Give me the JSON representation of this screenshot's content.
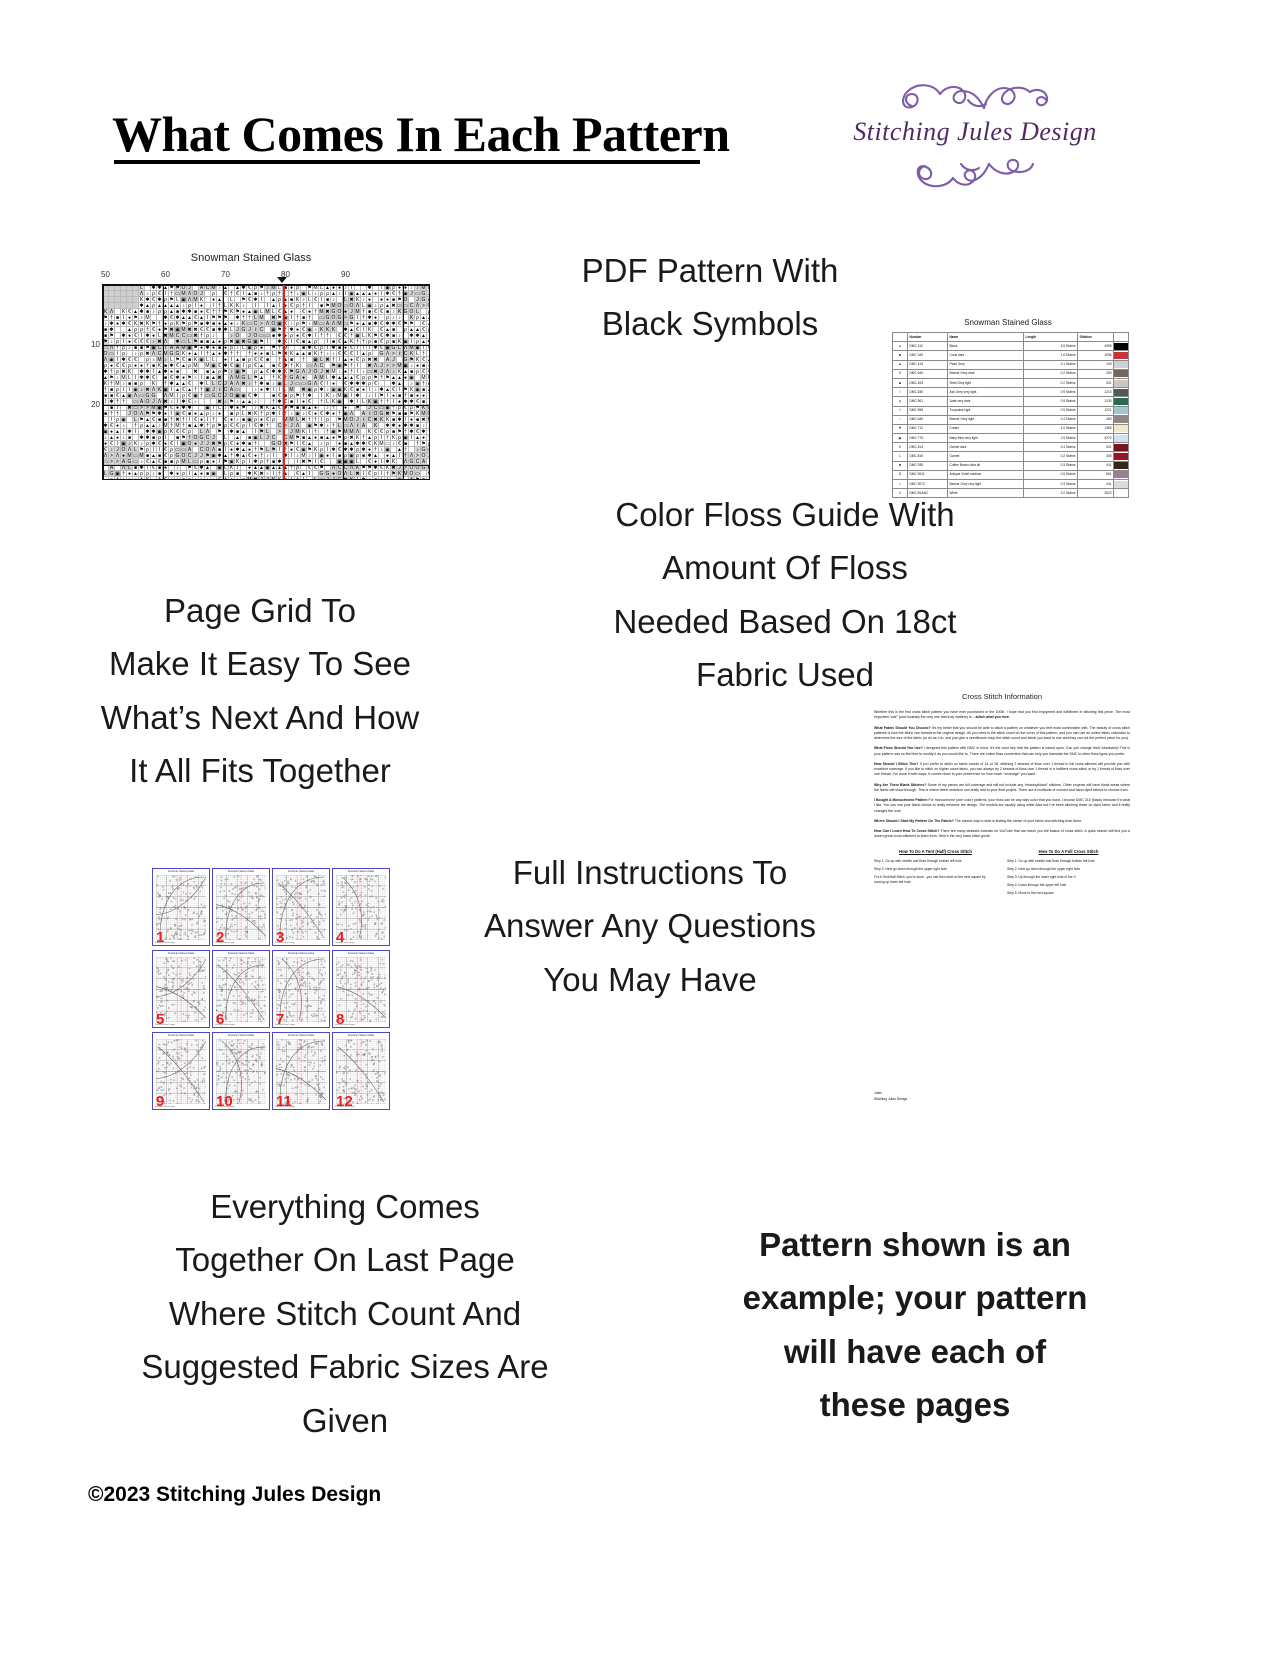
{
  "header": {
    "title": "What Comes In Each Pattern",
    "logo": {
      "brand": "Stitching Jules Design",
      "flourish_top": "❧❁❦",
      "flourish_bottom": "❦❁❧",
      "text_color": "#512b63",
      "flourish_color": "#7f5da6"
    }
  },
  "callouts": {
    "pdf_pattern": "PDF Pattern With\nBlack Symbols",
    "floss_guide": "Color Floss Guide With\nAmount Of Floss\nNeeded Based On 18ct\nFabric Used",
    "page_grid": "Page Grid To\nMake It Easy To See\nWhat’s Next And How\nIt All Fits Together",
    "instructions": "Full Instructions To\nAnswer Any Questions\nYou May Have",
    "last_page": "Everything Comes\nTogether On Last Page\nWhere Stitch Count And\nSuggested Fabric Sizes Are\nGiven",
    "disclaimer": "Pattern shown is an\nexample; your pattern\nwill have each of\nthese pages"
  },
  "footer": {
    "copyright": "©2023 Stitching Jules Design"
  },
  "chart": {
    "title": "Snowman Stained Glass",
    "column_labels": [
      "50",
      "60",
      "70",
      "80",
      "90"
    ],
    "row_labels": [
      "10",
      "20"
    ],
    "center_line_color": "#e8211a",
    "symbols": [
      "●",
      "✱",
      "▲",
      "€",
      "■",
      "I",
      "ρ",
      "†",
      "♪",
      "⚑",
      "▣",
      "K",
      "L",
      "✖",
      "M",
      "▭",
      "Λ",
      "G",
      "J",
      "O",
      "C",
      "A",
      ">",
      "ℓ"
    ]
  },
  "floss_guide": {
    "title": "Snowman Stained Glass",
    "columns": [
      "",
      "Number",
      "Name",
      "Length",
      "Stitches",
      ""
    ],
    "rows": [
      {
        "symbol": "●",
        "number": "DMC    310",
        "name": "Black",
        "length": "3.5 Skeins",
        "stitches": "4999",
        "color": "#000000"
      },
      {
        "symbol": "✱",
        "number": "DMC    349",
        "name": "Coral dark",
        "length": "1.6 Skeins",
        "stitches": "1096",
        "color": "#c4343b"
      },
      {
        "symbol": "▲",
        "number": "DMC    415",
        "name": "Pearl Grey",
        "length": "0.1 Skeins",
        "stitches": "109",
        "color": "#ced2d6"
      },
      {
        "symbol": "€",
        "number": "DMC    646",
        "name": "Beaver Grey dark",
        "length": "0.2 Skeins",
        "stitches": "250",
        "color": "#6e6a63"
      },
      {
        "symbol": "■",
        "number": "DMC    453",
        "name": "Shell Grey light",
        "length": "0.2 Skeins",
        "stitches": "321",
        "color": "#cfc6bf"
      },
      {
        "symbol": "I",
        "number": "DMC    535",
        "name": "Ash Grey very light",
        "length": "0.9 Skeins",
        "stitches": "1210",
        "color": "#55575a"
      },
      {
        "symbol": "ρ",
        "number": "DMC    561",
        "name": "Jade very dark",
        "length": "0.9 Skeins",
        "stitches": "1230",
        "color": "#2b6b4f"
      },
      {
        "symbol": "†",
        "number": "DMC    598",
        "name": "Turquoise light",
        "length": "0.9 Skeins",
        "stitches": "1221",
        "color": "#9ec9cf"
      },
      {
        "symbol": "♪",
        "number": "DMC    646",
        "name": "Beaver Grey light",
        "length": "0.4 Skeins",
        "stitches": "483",
        "color": "#8d8880"
      },
      {
        "symbol": "⚑",
        "number": "DMC    712",
        "name": "Cream",
        "length": "1.0 Skeins",
        "stitches": "1383",
        "color": "#f2e6cf"
      },
      {
        "symbol": "▣",
        "number": "DMC    775",
        "name": "Baby Blue very light",
        "length": "2.5 Skeins",
        "stitches": "3270",
        "color": "#cfe0ee"
      },
      {
        "symbol": "K",
        "number": "DMC    814",
        "name": "Garnet dark",
        "length": "0.4 Skeins",
        "stitches": "521",
        "color": "#7b1020"
      },
      {
        "symbol": "L",
        "number": "DMC    816",
        "name": "Garnet",
        "length": "0.2 Skeins",
        "stitches": "305",
        "color": "#971325"
      },
      {
        "symbol": "✖",
        "number": "DMC    938",
        "name": "Coffee Brown ultra dk",
        "length": "0.3 Skeins",
        "stitches": "441",
        "color": "#3b2317"
      },
      {
        "symbol": "D",
        "number": "DMC   3041",
        "name": "Antique Violet medium",
        "length": "0.5 Skeins",
        "stitches": "661",
        "color": "#9a7f92"
      },
      {
        "symbol": ">",
        "number": "DMC   3072",
        "name": "Beaver Grey very light",
        "length": "0.3 Skeins",
        "stitches": "441",
        "color": "#dcdcd4"
      },
      {
        "symbol": "Λ",
        "number": "DMC  BLANC",
        "name": "White",
        "length": "2.0 Skeins",
        "stitches": "2622",
        "color": "#ffffff"
      }
    ]
  },
  "page_grid": {
    "thumb_title": "Snowman Stained Glass",
    "thumb_footer": "Stitching Jules Design",
    "page_numbers": [
      "1",
      "2",
      "3",
      "4",
      "5",
      "6",
      "7",
      "8",
      "9",
      "10",
      "11",
      "12"
    ],
    "border_color": "#4b49c9",
    "number_color": "#ee1c1c"
  },
  "instructions": {
    "title": "Cross Stitch Information",
    "intro": "Whether this is the first cross stitch pattern you have ever purchased or the 100th, I hope that you find enjoyment and fulfillment in stitching this piece. The most important “rule” (and honestly the only one that truly matters) is – stitch what you love.",
    "intro_emphasis": "stitch what you love.",
    "sections": [
      {
        "heading": "What Fabric Should You Choose?",
        "body": " It’s my belief that you should be able to stitch a pattern on whatever you feel most comfortable with. The beauty of cross stitch patterns is how the fabric can transform the original design. All you need is the stitch count on the cover of this pattern, and you can use an online fabric calculator to determine the size of the fabric (or do as I do, and just give a needlework shop the stitch count and fabric you want to use and they can cut the perfect piece for you)."
      },
      {
        "heading": "What Floss Should You Use?",
        "body": " I designed this pattern with DMC in mind. It’s the color key that the pattern is based upon. Can you change that? Absolutely! This is your pattern now so feel free to modify it as you would like to. There are online floss converters that can help you translate the DMC to other floss types you prefer."
      },
      {
        "heading": "How Should I Stitch This?",
        "body": " If you prefer to stitch on fabric counts of 14 or 18, stitching 2 strands of floss over 1 thread in full cross-stitches will provide you with excellent coverage. If you like to stitch on higher count fabric, you can always try 2 strands of floss over 1 thread in a half/tent cross-stitch or try 1 thread of floss over one thread. I’ve done it both ways. It comes down to your preference for how much “coverage” you want."
      },
      {
        "heading": "Why Are There Blank Stitches?",
        "body": " Some of my pieces are full-coverage and will not include any “missing/blank” stitches. Other projects will have blank areas where the fabric will show through. This is where fabric selection can really add to your final project. There are a multitude of colored and hand-dyed fabrics to choose from."
      },
      {
        "heading": "I Bought A Monochrome Pattern",
        "body": " For monochrome (one color) patterns, your floss can be any dark color that you want. I choose DMC 310 (black) because it’s what I like. You can use your fabric choice to really enhance the design. The models are usually using white Aida but I’ve been stitching these on dyed fabric and it really changes the look."
      },
      {
        "heading": "Where Should I Start My Pattern On The Fabric?",
        "body": " The classic way to start is finding the center of your fabric and stitching from there."
      },
      {
        "heading": "How Can I Learn How To Cross Stitch?",
        "body": " There are many fantastic tutorials on YouTube that can teach you the basics of cross stitch. A quick search will find you a dozen great cross-stitchers to learn from. Here’s the very basic stitch guide."
      }
    ],
    "tent_stitch": {
      "heading": "How To Do A Tent (Half) Cross Stitch",
      "steps": [
        "Step 1. Go up with needle and floss through bottom left hole",
        "Step 2. Next go down through the upper right hole"
      ],
      "note": "For A Tent/Half Stitch, you’re done - you can then start on the next square by coming up lower left hole."
    },
    "full_stitch": {
      "heading": "How To Do A Full Cross Stitch",
      "steps": [
        "Step 1. Go up with needle and floss through bottom left hole",
        "Step 2. Next go down through the upper right hole",
        "Step 3. Up through the lower right hole of the X",
        "Step 4. Down through the upper left hole",
        "Step 5. Move to the next square"
      ]
    },
    "signature": "Jules\nStitching Jules Design"
  }
}
